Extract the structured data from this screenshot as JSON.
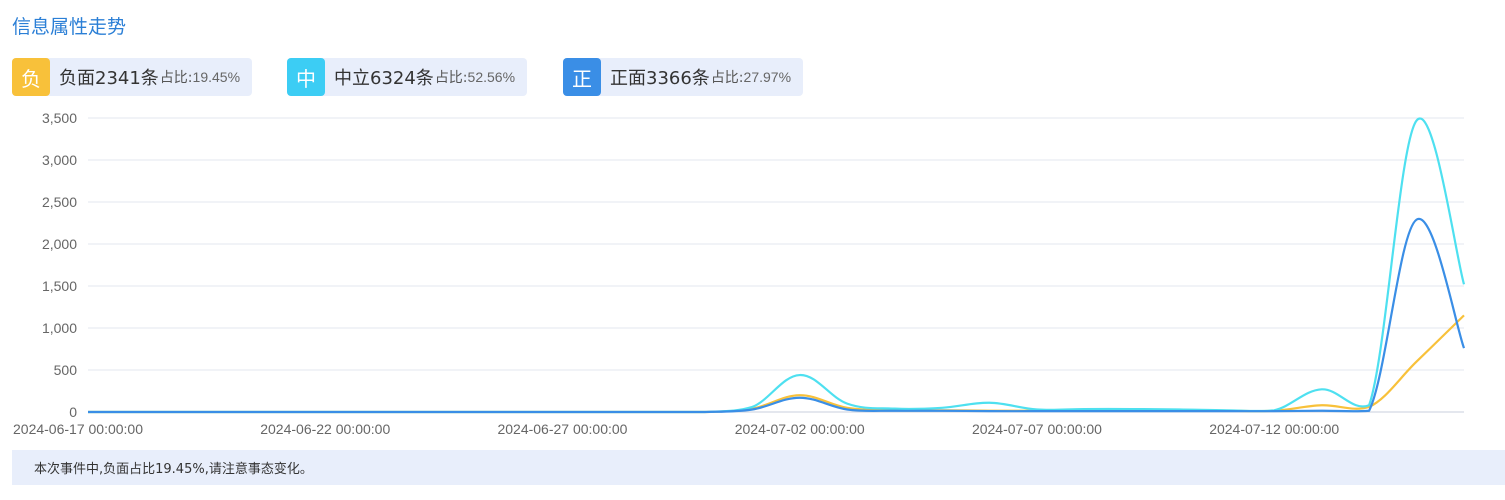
{
  "title": "信息属性走势",
  "badges": [
    {
      "icon": "负",
      "label": "负面2341条",
      "ratio_label": "占比:",
      "ratio_value": "19.45%",
      "color": "#f8c13a"
    },
    {
      "icon": "中",
      "label": "中立6324条",
      "ratio_label": "占比:",
      "ratio_value": "52.56%",
      "color": "#3ccdf4"
    },
    {
      "icon": "正",
      "label": "正面3366条",
      "ratio_label": "占比:",
      "ratio_value": "27.97%",
      "color": "#3a8ee6"
    }
  ],
  "footer": {
    "text": "本次事件中,负面占比19.45%,请注意事态变化。"
  },
  "chart_data": {
    "type": "line",
    "ylim": [
      0,
      3500
    ],
    "yticks": [
      0,
      500,
      1000,
      1500,
      2000,
      2500,
      3000,
      3500
    ],
    "ytick_labels": [
      "0",
      "500",
      "1,000",
      "1,500",
      "2,000",
      "2,500",
      "3,000",
      "3,500"
    ],
    "xtick_labels": [
      "2024-06-17 00:00:00",
      "2024-06-22 00:00:00",
      "2024-06-27 00:00:00",
      "2024-07-02 00:00:00",
      "2024-07-07 00:00:00",
      "2024-07-12 00:00:00"
    ],
    "x": [
      "2024-06-17",
      "2024-06-18",
      "2024-06-19",
      "2024-06-20",
      "2024-06-21",
      "2024-06-22",
      "2024-06-23",
      "2024-06-24",
      "2024-06-25",
      "2024-06-26",
      "2024-06-27",
      "2024-06-28",
      "2024-06-29",
      "2024-06-30",
      "2024-07-01",
      "2024-07-02",
      "2024-07-03",
      "2024-07-04",
      "2024-07-05",
      "2024-07-06",
      "2024-07-07",
      "2024-07-08",
      "2024-07-09",
      "2024-07-10",
      "2024-07-11",
      "2024-07-12",
      "2024-07-13",
      "2024-07-14",
      "2024-07-15",
      "2024-07-16"
    ],
    "series": [
      {
        "color": "#f8c13a",
        "values": [
          0,
          0,
          0,
          0,
          0,
          0,
          0,
          0,
          0,
          0,
          0,
          0,
          0,
          0,
          40,
          200,
          50,
          20,
          20,
          15,
          15,
          15,
          15,
          15,
          15,
          15,
          80,
          60,
          600,
          1150
        ]
      },
      {
        "color": "#4ee0f0",
        "values": [
          0,
          0,
          0,
          0,
          0,
          0,
          0,
          0,
          0,
          0,
          0,
          0,
          0,
          0,
          60,
          440,
          100,
          40,
          50,
          110,
          30,
          35,
          35,
          30,
          20,
          20,
          270,
          80,
          3470,
          1520
        ]
      },
      {
        "color": "#3a8ee6",
        "values": [
          0,
          0,
          0,
          0,
          0,
          0,
          0,
          0,
          0,
          0,
          0,
          0,
          0,
          0,
          30,
          170,
          30,
          15,
          15,
          10,
          10,
          10,
          10,
          10,
          10,
          10,
          15,
          15,
          2290,
          760
        ]
      }
    ]
  }
}
